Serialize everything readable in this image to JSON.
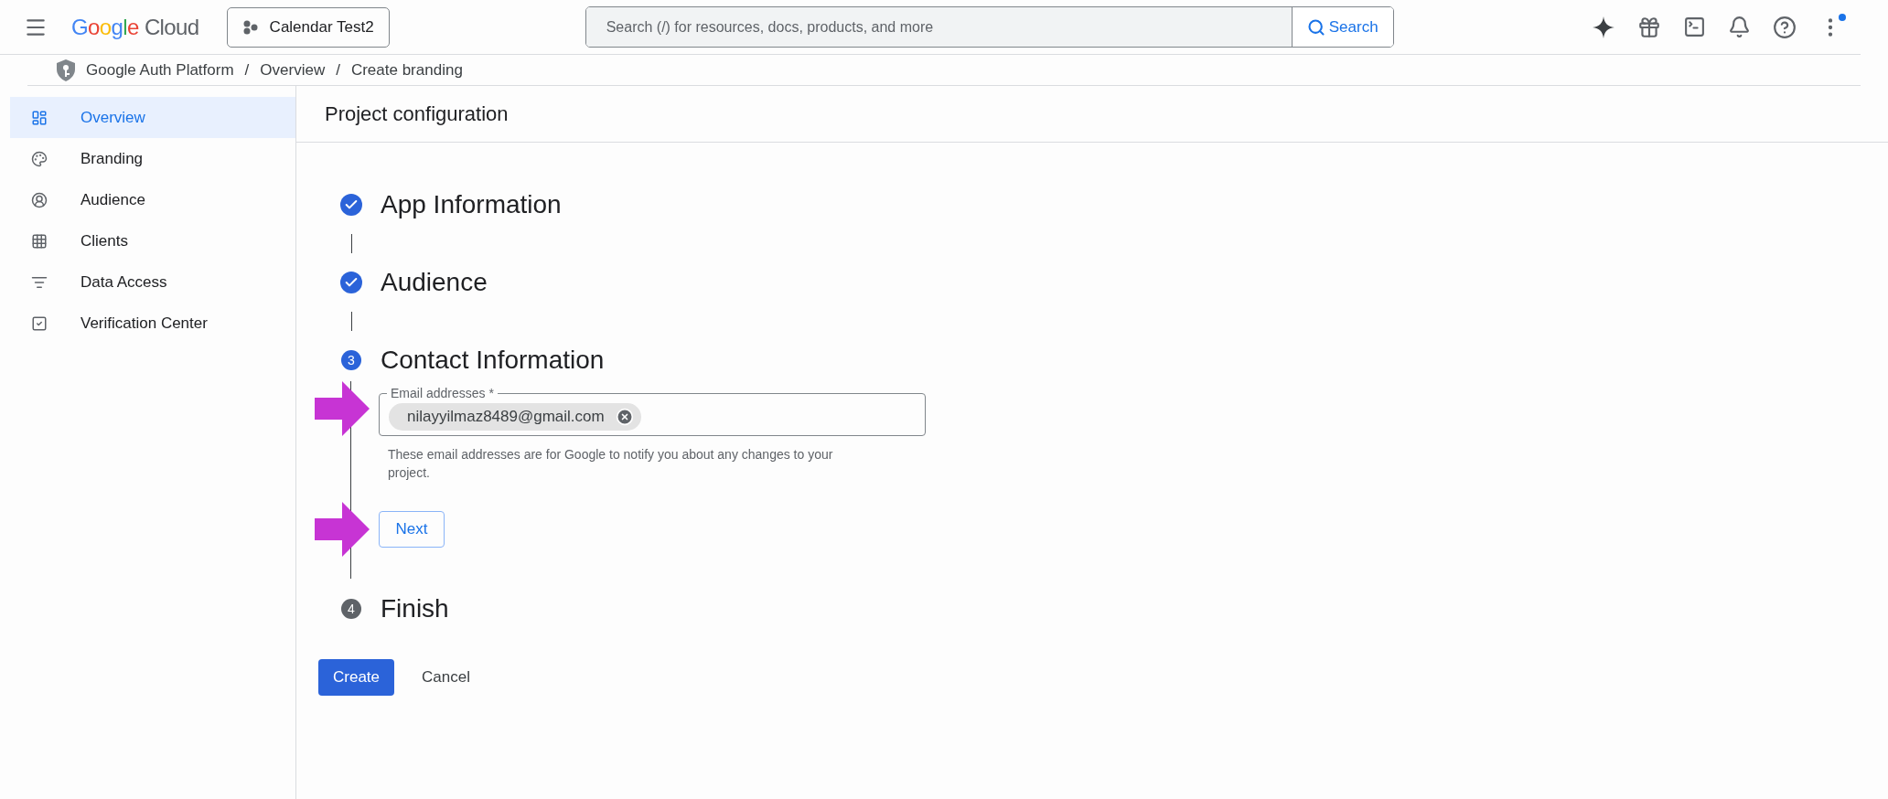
{
  "header": {
    "logo": {
      "brand": "Google",
      "product": "Cloud"
    },
    "project": "Calendar Test2",
    "search": {
      "placeholder": "Search (/) for resources, docs, products, and more",
      "button": "Search"
    },
    "notification_dot": true
  },
  "breadcrumb": {
    "items": [
      "Google Auth Platform",
      "Overview",
      "Create branding"
    ],
    "separator": "/"
  },
  "sidebar": {
    "items": [
      {
        "label": "Overview",
        "selected": true
      },
      {
        "label": "Branding",
        "selected": false
      },
      {
        "label": "Audience",
        "selected": false
      },
      {
        "label": "Clients",
        "selected": false
      },
      {
        "label": "Data Access",
        "selected": false
      },
      {
        "label": "Verification Center",
        "selected": false
      }
    ]
  },
  "page_title": "Project configuration",
  "steps": [
    {
      "title": "App Information",
      "completed": true,
      "active": false
    },
    {
      "title": "Audience",
      "completed": true,
      "active": false
    },
    {
      "number": "3",
      "title": "Contact Information",
      "completed": false,
      "active": true,
      "field": {
        "label": "Email addresses *",
        "chips": [
          "nilayyilmaz8489@gmail.com"
        ],
        "helper": "These email addresses are for Google to notify you about any changes to your project."
      },
      "next": "Next"
    },
    {
      "number": "4",
      "title": "Finish",
      "completed": false,
      "active": false
    }
  ],
  "actions": {
    "primary": "Create",
    "secondary": "Cancel"
  }
}
